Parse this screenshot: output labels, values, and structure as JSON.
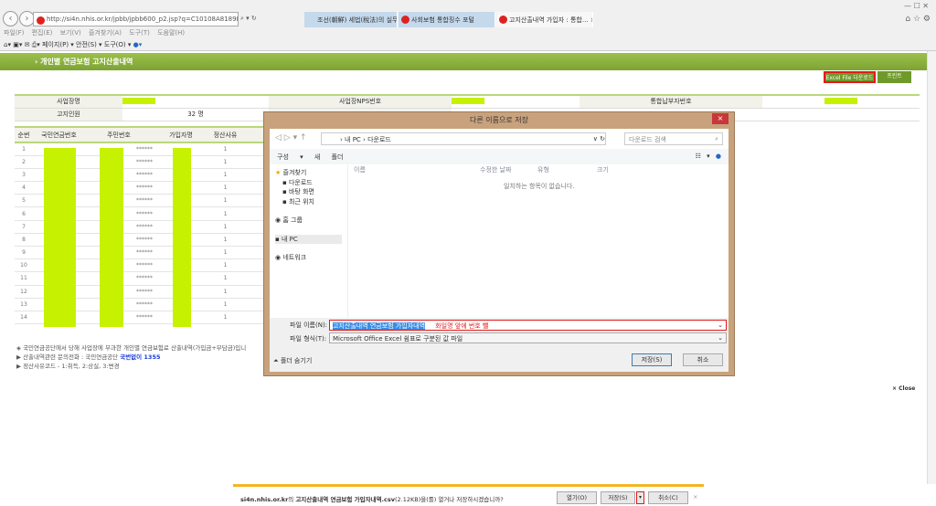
{
  "browser": {
    "url": "http://si4n.nhis.or.kr/jpbb/jpbb600_p2.jsp?q=C10108A8189E00158 7DB35C979620E2!",
    "tabs": [
      "조선(朝鮮) 세법(稅法)의 실무...",
      "사회보험 통합징수 포털",
      "고지산출내역 가입자 : 통합..."
    ],
    "menu": [
      "파일(F)",
      "편집(E)",
      "보기(V)",
      "즐겨찾기(A)",
      "도구(T)",
      "도움말(H)"
    ],
    "commands": [
      "페이지(P) ▾",
      "안전(S) ▾",
      "도구(O) ▾"
    ]
  },
  "page": {
    "title": "› 개인별 연금보험 고지산출내역",
    "excel_button": "Excel File 다운로드",
    "print_button": "프린트",
    "info": {
      "company_label": "사업장명",
      "nps_label": "사업장NPS번호",
      "integ_label": "통합납부자번호",
      "count_label": "고지인원",
      "count_value": "32 명"
    },
    "columns": [
      "순번",
      "국민연금번호",
      "주민번호",
      "가입자명",
      "정산사유"
    ],
    "rows": [
      {
        "n": "1",
        "rrn": "******",
        "code": "1"
      },
      {
        "n": "2",
        "rrn": "******",
        "code": "1"
      },
      {
        "n": "3",
        "rrn": "******",
        "code": "1"
      },
      {
        "n": "4",
        "rrn": "******",
        "code": "1"
      },
      {
        "n": "5",
        "rrn": "******",
        "code": "1"
      },
      {
        "n": "6",
        "rrn": "******",
        "code": "1"
      },
      {
        "n": "7",
        "rrn": "******",
        "code": "1"
      },
      {
        "n": "8",
        "rrn": "******",
        "code": "1"
      },
      {
        "n": "9",
        "rrn": "******",
        "code": "1"
      },
      {
        "n": "10",
        "rrn": "******",
        "code": "1"
      },
      {
        "n": "11",
        "rrn": "******",
        "code": "1"
      },
      {
        "n": "12",
        "rrn": "******",
        "code": "1"
      },
      {
        "n": "13",
        "rrn": "******",
        "code": "1"
      },
      {
        "n": "14",
        "rrn": "******",
        "code": "1"
      }
    ],
    "notes": [
      "◈ 국민연금공단에서 당해 사업장에 부과한 개인별 연금보험료 산출내역(가입금+부담금)입니",
      "▶ 산출내역관련 문의전화 : 국민연금공단",
      "▶ 정산사유코드 - 1:취득, 2:상실, 3:변경"
    ],
    "phone": "국번없이 1355",
    "close": "Close"
  },
  "dialog": {
    "title": "다른 이름으로 저장",
    "path": [
      "내 PC",
      "다운로드"
    ],
    "search_placeholder": "다운로드 검색",
    "organize": "구성 ▾",
    "new_folder": "새 폴더",
    "nav": [
      "즐겨찾기",
      "다운로드",
      "바탕 화면",
      "최근 위치",
      "홈 그룹",
      "내 PC",
      "네트워크"
    ],
    "columns": [
      "이름",
      "수정한 날짜",
      "유형",
      "크기"
    ],
    "empty": "일치하는 항목이 없습니다.",
    "filename_label": "파일 이름(N):",
    "filename_value": "고지산출내역 연금보험 가입자내역",
    "filename_note": "화일명 앞에 번호 뺄",
    "filetype_label": "파일 형식(T):",
    "filetype_value": "Microsoft Office Excel 쉼표로 구분된 값 파일",
    "hide_folders": "폴더 숨기기",
    "save": "저장(S)",
    "cancel": "취소"
  },
  "download": {
    "host": "si4n.nhis.or.kr",
    "message_mid": "의 ",
    "file": "고지산출내역 연금보험 가입자내역.csv",
    "message_end": "(2.12KB)을(를) 열거나 저장하시겠습니까?",
    "open": "열기(O)",
    "save": "저장(S)",
    "cancel": "취소(C)"
  }
}
